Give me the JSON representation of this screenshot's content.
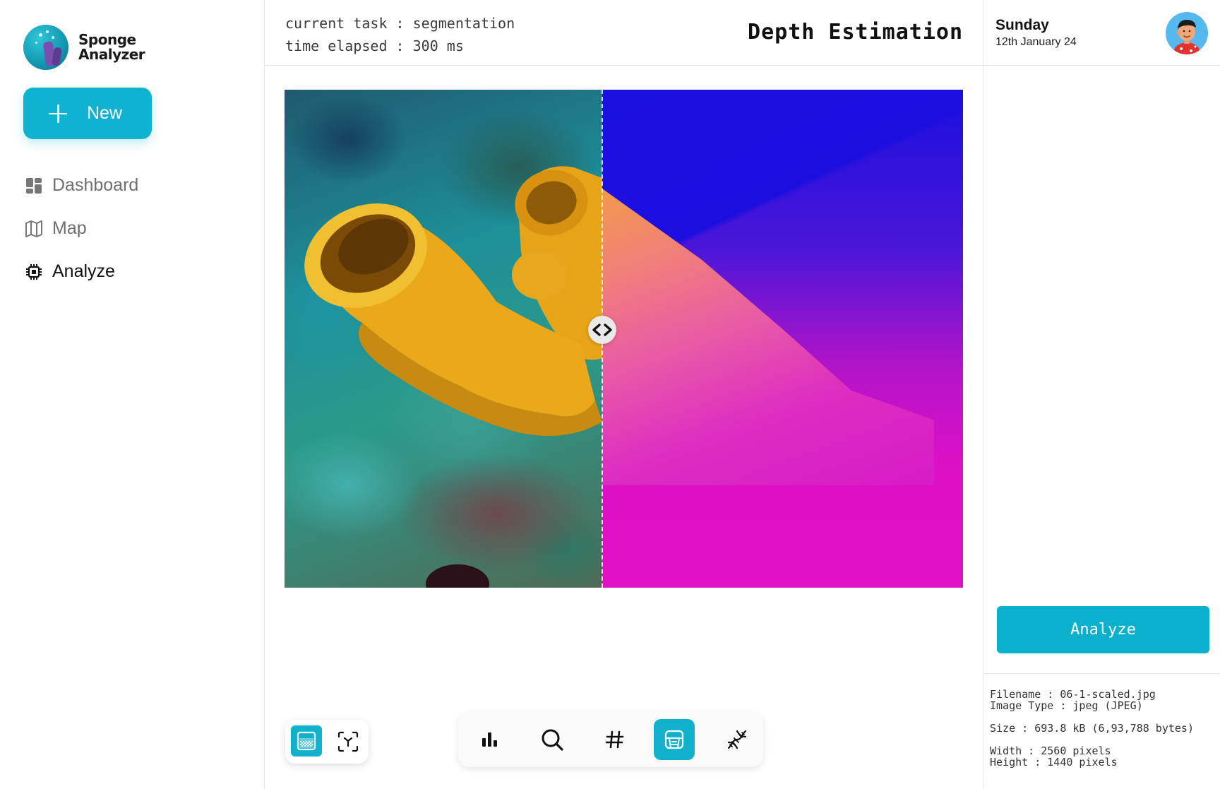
{
  "brand": {
    "line1": "Sponge",
    "line2": "Analyzer"
  },
  "sidebar": {
    "new_label": "New",
    "items": [
      {
        "label": "Dashboard",
        "icon": "dashboard-icon",
        "active": false
      },
      {
        "label": "Map",
        "icon": "map-icon",
        "active": false
      },
      {
        "label": "Analyze",
        "icon": "chip-icon",
        "active": true
      }
    ]
  },
  "header": {
    "task_line": "current task : segmentation",
    "time_line": "time elapsed : 300 ms",
    "title": "Depth Estimation"
  },
  "viewer": {
    "left_image": "sponge-reef-photo",
    "right_image": "depth-map",
    "slider_position": 0.47
  },
  "view_toggle": [
    {
      "icon": "gradient-image-icon",
      "active": true
    },
    {
      "icon": "focus-frame-icon",
      "active": false
    }
  ],
  "tools": [
    {
      "icon": "bar-chart-icon",
      "active": false
    },
    {
      "icon": "search-icon",
      "active": false
    },
    {
      "icon": "hash-icon",
      "active": false
    },
    {
      "icon": "depth-view-icon",
      "active": true
    },
    {
      "icon": "dna-icon",
      "active": false
    }
  ],
  "right_panel": {
    "day": "Sunday",
    "date": "12th January 24",
    "analyze_label": "Analyze",
    "meta": {
      "filename": "Filename : 06-1-scaled.jpg",
      "image_type": "Image Type : jpeg (JPEG)",
      "size": "Size : 693.8 kB (6,93,788 bytes)",
      "width": "Width : 2560 pixels",
      "height": "Height : 1440 pixels"
    }
  },
  "colors": {
    "accent": "#0fb2cf",
    "text": "#111111",
    "muted": "#6f6f6f",
    "border": "#e6e6e6"
  }
}
